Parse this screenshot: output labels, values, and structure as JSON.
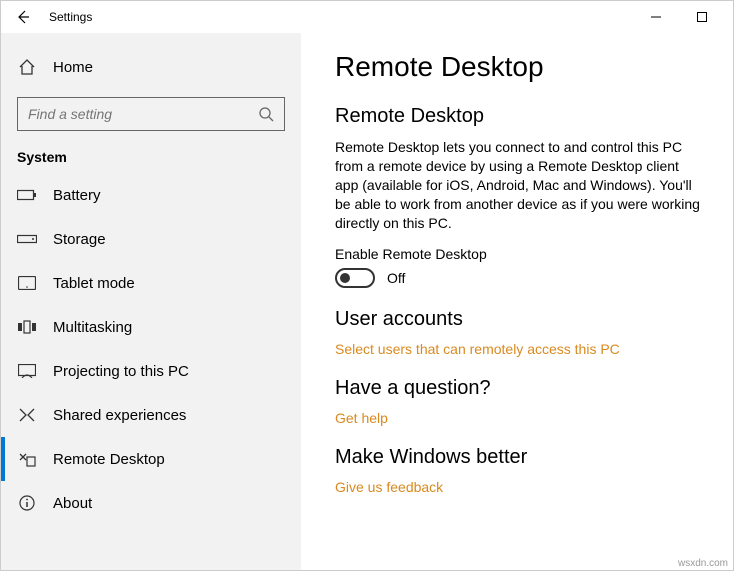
{
  "titlebar": {
    "app_title": "Settings"
  },
  "sidebar": {
    "home_label": "Home",
    "search_placeholder": "Find a setting",
    "group_label": "System",
    "items": [
      {
        "label": "Battery"
      },
      {
        "label": "Storage"
      },
      {
        "label": "Tablet mode"
      },
      {
        "label": "Multitasking"
      },
      {
        "label": "Projecting to this PC"
      },
      {
        "label": "Shared experiences"
      },
      {
        "label": "Remote Desktop"
      },
      {
        "label": "About"
      }
    ]
  },
  "content": {
    "page_title": "Remote Desktop",
    "section1_title": "Remote Desktop",
    "section1_desc": "Remote Desktop lets you connect to and control this PC from a remote device by using a Remote Desktop client app (available for iOS, Android, Mac and Windows). You'll be able to work from another device as if you were working directly on this PC.",
    "toggle_label": "Enable Remote Desktop",
    "toggle_state": "Off",
    "section2_title": "User accounts",
    "section2_link": "Select users that can remotely access this PC",
    "section3_title": "Have a question?",
    "section3_link": "Get help",
    "section4_title": "Make Windows better",
    "section4_link": "Give us feedback"
  },
  "watermark": "wsxdn.com"
}
